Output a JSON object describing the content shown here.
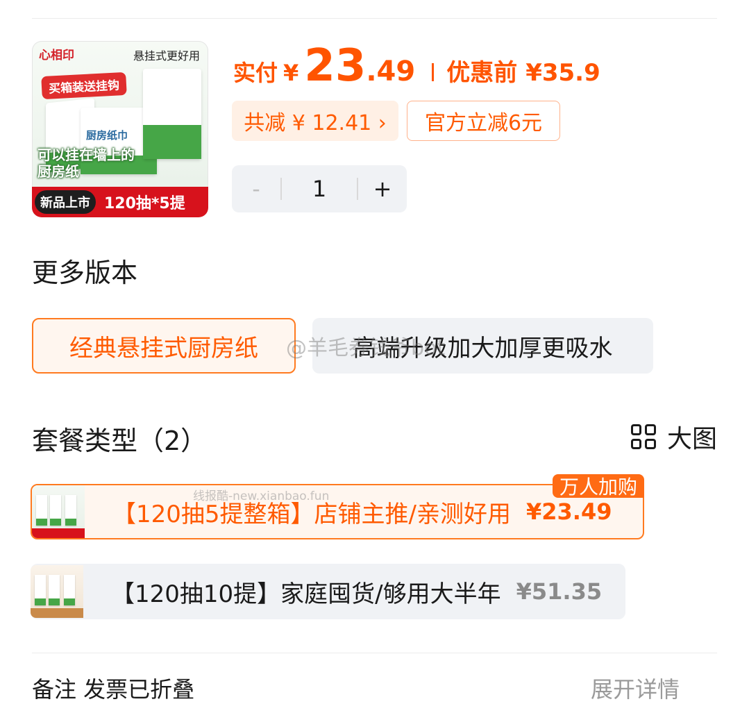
{
  "product": {
    "image": {
      "brand": "心相印",
      "tagline": "悬挂式更好用",
      "promo_tag": "买箱装送挂钩",
      "box_label": "厨房纸巾",
      "caption_line1": "可以挂在墙上的",
      "caption_line2": "厨房纸",
      "new_badge": "新品上市",
      "spec": "120抽*5提"
    },
    "price": {
      "label": "实付",
      "currency": "¥",
      "integer": "23",
      "decimal": ".49",
      "before_label": "优惠前",
      "before_value": "¥35.9"
    },
    "discounts": {
      "total_saved": "共减 ¥ 12.41 ›",
      "official_off": "官方立减6元"
    },
    "quantity": {
      "minus": "-",
      "value": "1",
      "plus": "+"
    }
  },
  "versions": {
    "title": "更多版本",
    "options": [
      {
        "label": "经典悬挂式厨房纸",
        "selected": true
      },
      {
        "label": "高端升级加大加厚更吸水",
        "selected": false
      }
    ]
  },
  "watermark": {
    "weibo": "@羊毛券钱爷bot",
    "site": "线报酷-new.xianbao.fun"
  },
  "packages": {
    "title": "套餐类型（2）",
    "view_toggle": "大图",
    "items": [
      {
        "name": "【120抽5提整箱】店铺主推/亲测好用",
        "price": "¥23.49",
        "badge": "万人加购",
        "selected": true
      },
      {
        "name": "【120抽10提】家庭囤货/够用大半年",
        "price": "¥51.35",
        "selected": false
      }
    ]
  },
  "remark": {
    "left": "备注  发票已折叠",
    "right": "展开详情"
  },
  "colors": {
    "accent": "#ff5a00",
    "accent_bg": "#fff6ef",
    "neutral_bg": "#f0f2f5",
    "brand_red": "#d7121c"
  }
}
